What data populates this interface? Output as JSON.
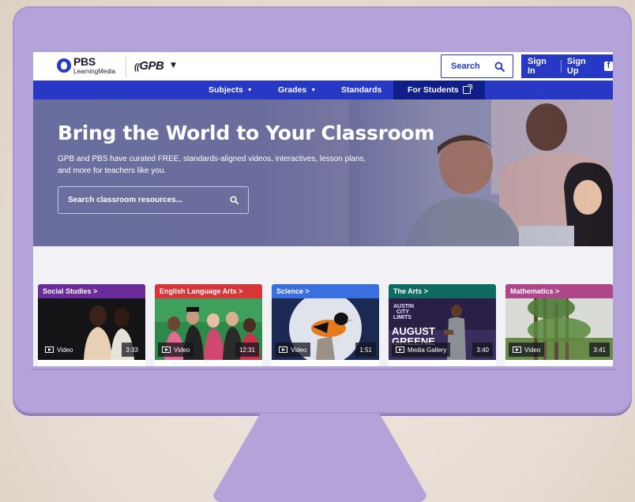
{
  "site": {
    "logo_word": "PBS",
    "logo_sub": "LearningMedia",
    "partner_logo": "GPB"
  },
  "header": {
    "search_label": "Search",
    "sign_in": "Sign In",
    "sign_up": "Sign Up"
  },
  "nav": {
    "items": [
      {
        "label": "Subjects",
        "has_dropdown": true
      },
      {
        "label": "Grades",
        "has_dropdown": true
      },
      {
        "label": "Standards",
        "has_dropdown": false
      },
      {
        "label": "For Students",
        "external": true,
        "active": true
      }
    ]
  },
  "hero": {
    "title": "Bring the World to Your Classroom",
    "description": "GPB and PBS have curated FREE, standards-aligned videos, interactives, lesson plans, and more for teachers like you.",
    "search_placeholder": "Search classroom resources..."
  },
  "cards": [
    {
      "category": "Social Studies >",
      "type": "Video",
      "duration": "3:33",
      "color": "#6b2c9b"
    },
    {
      "category": "English Language Arts >",
      "type": "Video",
      "duration": "12:31",
      "color": "#d6363a"
    },
    {
      "category": "Science >",
      "type": "Video",
      "duration": "1:51",
      "color": "#3a6fe0"
    },
    {
      "category": "The Arts >",
      "type": "Media Gallery",
      "duration": "3:40",
      "color": "#0f6a62"
    },
    {
      "category": "Mathematics >",
      "type": "Video",
      "duration": "3:41",
      "color": "#b0468a"
    }
  ],
  "thumb_text": {
    "arts_line1": "AUSTIN",
    "arts_line2": "CITY",
    "arts_line3": "LIMITS",
    "arts_title1": "AUGUST",
    "arts_title2": "GREENE"
  },
  "colors": {
    "brand_blue": "#2638c4",
    "nav_active": "#101e8a",
    "monitor": "#b3a3d8"
  }
}
